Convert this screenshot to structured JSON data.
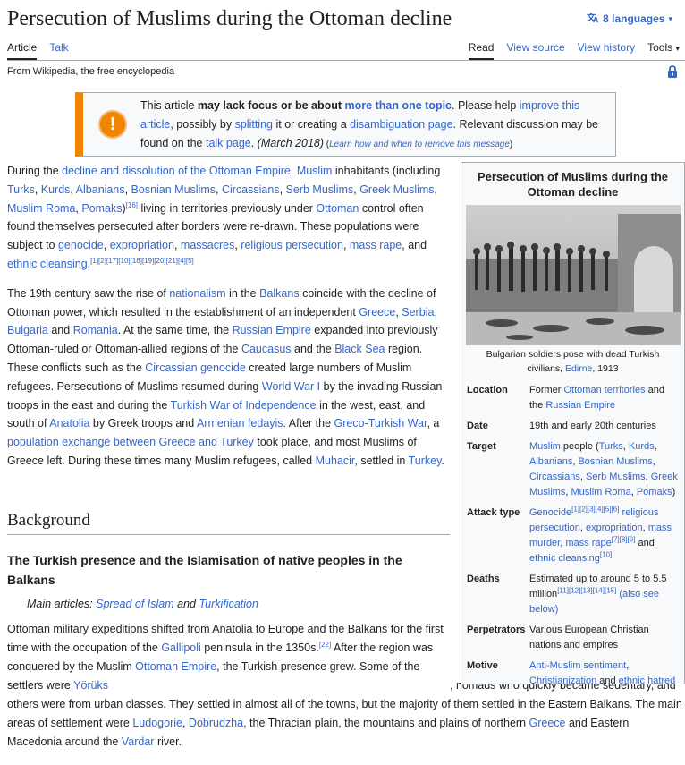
{
  "title": "Persecution of Muslims during the Ottoman decline",
  "languages": "8 languages",
  "tabs": {
    "article": "Article",
    "talk": "Talk",
    "read": "Read",
    "view_source": "View source",
    "view_history": "View history",
    "tools": "Tools"
  },
  "tagline": "From Wikipedia, the free encyclopedia",
  "ambox": {
    "t1": "This article ",
    "t2": "may lack focus or be about ",
    "t3": "more than one topic",
    "t4": ". Please help ",
    "t5": "improve this article",
    "t6": ", possibly by ",
    "t7": "splitting",
    "t8": " it or creating a ",
    "t9": "disambiguation page",
    "t10": ". Relevant discussion may be found on the ",
    "t11": "talk page",
    "t12": ". ",
    "t13": "(March 2018)",
    "t14": " (",
    "t15": "Learn how and when to remove this message",
    "t16": ")"
  },
  "infobox": {
    "title": "Persecution of Muslims during the Ottoman decline",
    "caption_a": "Bulgarian soldiers pose with dead Turkish civilians, ",
    "caption_link": "Edirne",
    "caption_b": ", 1913",
    "rows": {
      "location_label": "Location",
      "location_a": "Former ",
      "location_l1": "Ottoman territories",
      "location_b": " and the ",
      "location_l2": "Russian Empire",
      "date_label": "Date",
      "date_value": "19th and early 20th centuries",
      "target_label": "Target",
      "target_l1": "Muslim",
      "target_a": " people (",
      "target_l2": "Turks",
      "target_l3": "Kurds",
      "target_l4": "Albanians",
      "target_l5": "Bosnian Muslims",
      "target_l6": "Circassians",
      "target_l7": "Serb Muslims",
      "target_l8": "Greek Muslims",
      "target_l9": "Muslim Roma",
      "target_l10": "Pomaks",
      "target_b": ")",
      "attack_label": "Attack type",
      "attack_l1": "Genocide",
      "attack_s1": "[1][2][3][4][5][6]",
      "attack_l2": "religious persecution",
      "attack_l3": "expropriation",
      "attack_l4": "mass murder",
      "attack_l5": "mass rape",
      "attack_s2": "[7][8][9]",
      "attack_and": " and ",
      "attack_l6": "ethnic cleansing",
      "attack_s3": "[10]",
      "deaths_label": "Deaths",
      "deaths_value": "Estimated up to around 5 to 5.5 million",
      "deaths_s": "[11][12][13][14][15]",
      "deaths_link": "(also see below)",
      "perp_label": "Perpetrators",
      "perp_value": "Various European Christian nations and empires",
      "motive_label": "Motive",
      "motive_l1": "Anti-Muslim sentiment",
      "motive_l2": "Christianization",
      "motive_and": " and ",
      "motive_l3": "ethnic hatred"
    }
  },
  "p1": {
    "a": "During the ",
    "l1": "decline and dissolution of the Ottoman Empire",
    "b": ", ",
    "l2": "Muslim",
    "c": " inhabitants (including ",
    "l3": "Turks",
    "l4": "Kurds",
    "l5": "Albanians",
    "l6": "Bosnian Muslims",
    "l7": "Circassians",
    "l8": "Serb Muslims",
    "l9": "Greek Muslims",
    "l10": "Muslim Roma",
    "l11": "Pomaks",
    "d": ")",
    "s1": "[16]",
    "e": " living in territories previously under ",
    "l12": "Ottoman",
    "f": " control often found themselves persecuted after borders were re-drawn. These populations were subject to ",
    "l13": "genocide",
    "l14": "expropriation",
    "l15": "massacres",
    "l16": "religious persecution",
    "l17": "mass rape",
    "g": ", and ",
    "l18": "ethnic cleansing",
    "h": ".",
    "s2": "[1][2][17][10][18][19][20][21][4][5]"
  },
  "p2": {
    "a": "The 19th century saw the rise of ",
    "l1": "nationalism",
    "b": " in the ",
    "l2": "Balkans",
    "c": " coincide with the decline of Ottoman power, which resulted in the establishment of an independent ",
    "l3": "Greece",
    "l4": "Serbia",
    "l5": "Bulgaria",
    "d": " and ",
    "l6": "Romania",
    "e": ". At the same time, the ",
    "l7": "Russian Empire",
    "f": " expanded into previously Ottoman-ruled or Ottoman-allied regions of the ",
    "l8": "Caucasus",
    "g": " and the ",
    "l9": "Black Sea",
    "h": " region. These conflicts such as the ",
    "l10": "Circassian genocide",
    "i": " created large numbers of Muslim refugees. Persecutions of Muslims resumed during ",
    "l11": "World War I",
    "j": " by the invading Russian troops in the east and during the ",
    "l12": "Turkish War of Independence",
    "k": " in the west, east, and south of ",
    "l13": "Anatolia",
    "m": " by Greek troops and ",
    "l14": "Armenian fedayis",
    "n": ". After the ",
    "l15": "Greco-Turkish War",
    "o": ", a ",
    "l16": "population exchange between Greece and Turkey",
    "p": " took place, and most Muslims of Greece left. During these times many Muslim refugees, called ",
    "l17": "Muhacir",
    "q": ", settled in ",
    "l18": "Turkey",
    "r": "."
  },
  "h2": "Background",
  "h3": "The Turkish presence and the Islamisation of native peoples in the Balkans",
  "hatnote": {
    "a": "Main articles: ",
    "l1": "Spread of Islam",
    "b": " and ",
    "l2": "Turkification"
  },
  "p3": {
    "a": "Ottoman military expeditions shifted from Anatolia to Europe and the Balkans for the first time with the occupation of the ",
    "l1": "Gallipoli",
    "b": " peninsula in the 1350s.",
    "s1": "[22]",
    "c": " After the region was conquered by the Muslim ",
    "l2": "Ottoman Empire",
    "d": ", the Turkish presence grew. Some of the settlers were ",
    "l3": "Yörüks",
    "e": ", nomads who quickly became sedentary, and others were from urban classes. They settled in almost all of the towns, but the majority of them settled in the Eastern Balkans. The main areas of settlement were ",
    "l4": "Ludogorie",
    "f": ", ",
    "l5": "Dobrudzha",
    "g": ", the Thracian plain, the mountains and plains of northern ",
    "l6": "Greece",
    "h": " and Eastern Macedonia around the ",
    "l7": "Vardar",
    "i": " river."
  }
}
